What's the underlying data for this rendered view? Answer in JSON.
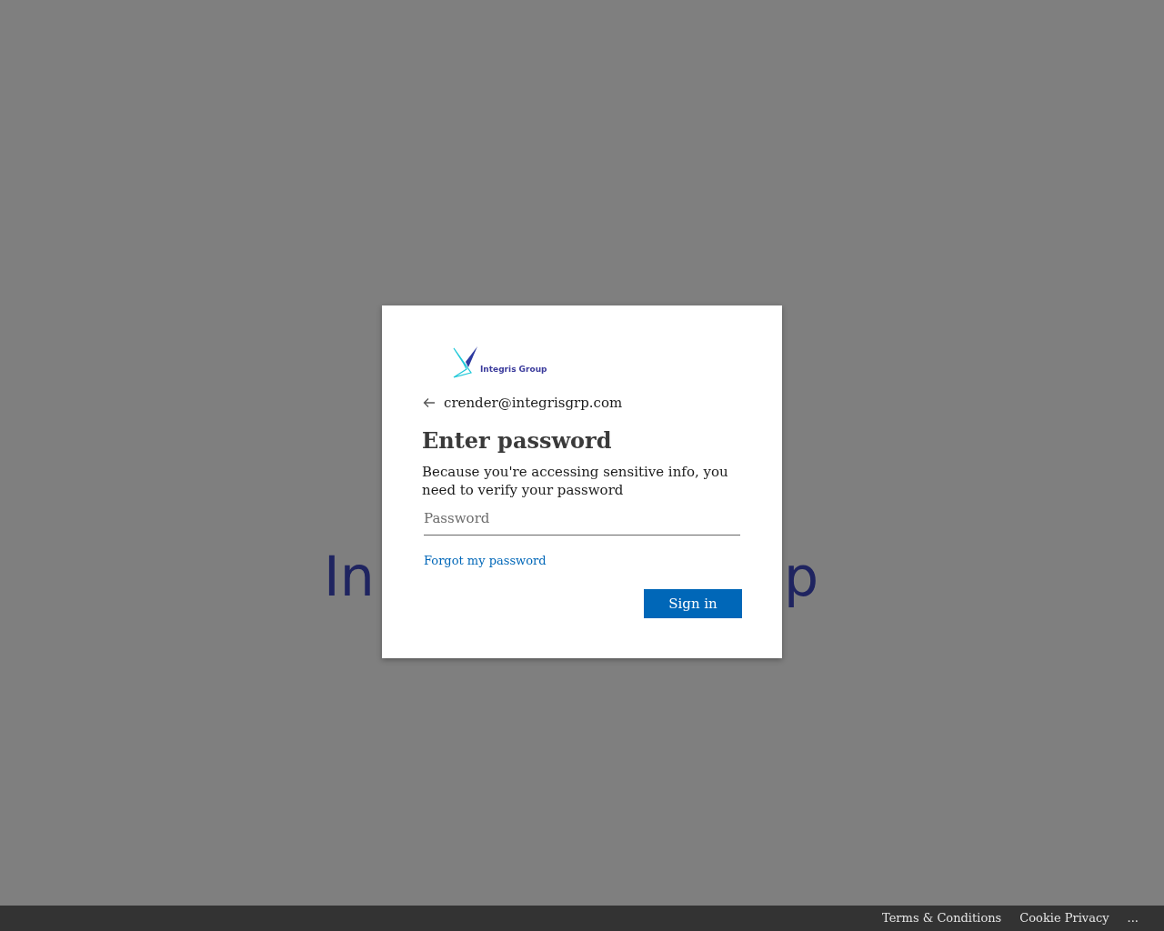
{
  "background_text": [
    "In",
    "p"
  ],
  "dialog": {
    "logo_text": "Integris Group",
    "account": "crender@integrisgrp.com",
    "title": "Enter password",
    "description": "Because you're accessing sensitive info, you need to verify your password",
    "password_field": {
      "placeholder": "Password"
    },
    "forgot_link": "Forgot my password",
    "button": "Sign in"
  },
  "footer": [
    "Terms & Conditions",
    "Cookie Privacy",
    "..."
  ]
}
